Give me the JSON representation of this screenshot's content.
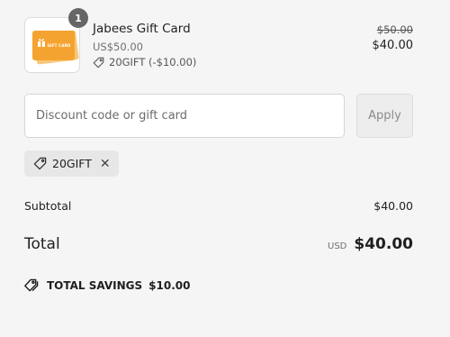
{
  "line_item": {
    "quantity": "1",
    "name": "Jabees Gift Card",
    "variant": "US$50.00",
    "discount_applied": "20GIFT (-$10.00)",
    "original_price": "$50.00",
    "price": "$40.00",
    "thumbnail_text": "GIFT CARD",
    "thumbnail_color": "#f5a330"
  },
  "discount_form": {
    "placeholder": "Discount code or gift card",
    "value": "",
    "apply_label": "Apply"
  },
  "applied_code": {
    "code": "20GIFT",
    "icon": "tag-icon",
    "remove_icon": "close-icon"
  },
  "summary": {
    "subtotal_label": "Subtotal",
    "subtotal_value": "$40.00",
    "total_label": "Total",
    "currency": "USD",
    "total_value": "$40.00",
    "savings_label": "TOTAL SAVINGS",
    "savings_value": "$10.00",
    "savings_icon": "tags-icon"
  },
  "colors": {
    "background": "#f5f5f5",
    "badge": "#666666",
    "tag_background": "#e7e7e7"
  }
}
